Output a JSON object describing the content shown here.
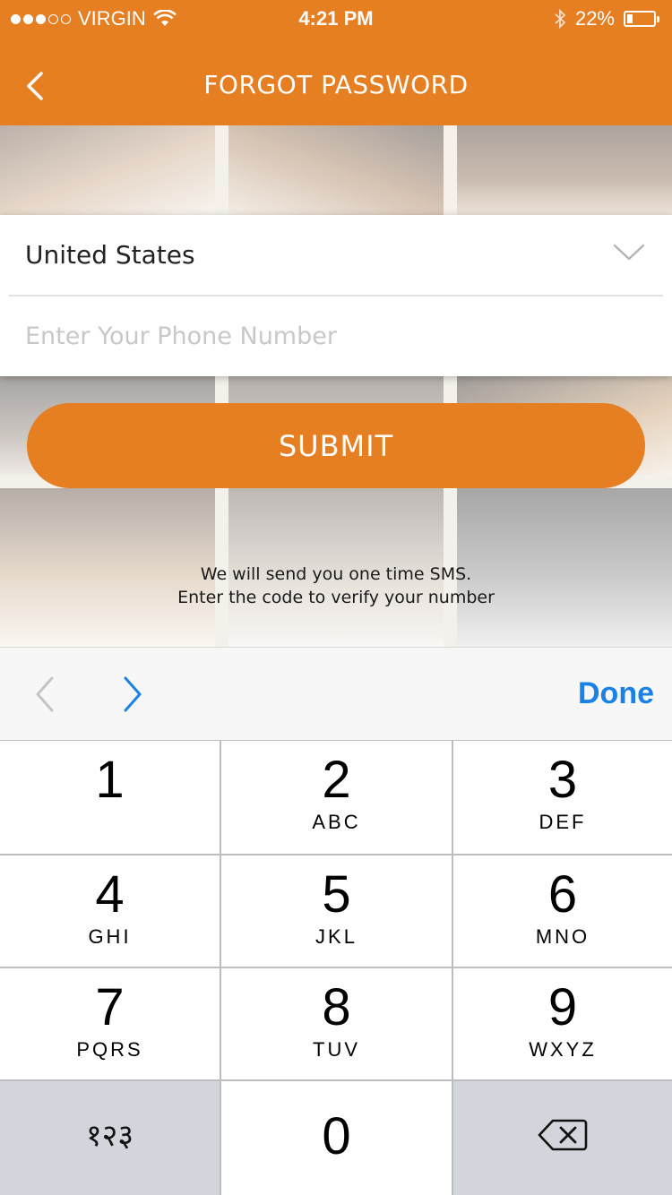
{
  "status_bar": {
    "carrier": "VIRGIN",
    "time": "4:21 PM",
    "battery": "22%",
    "battery_level": 0.22,
    "signal_bars_filled": 3,
    "signal_bars_total": 5
  },
  "nav": {
    "title": "FORGOT PASSWORD",
    "back_icon": "chevron-left-icon"
  },
  "form": {
    "country_value": "United States",
    "phone_placeholder": "Enter Your Phone Number",
    "phone_value": ""
  },
  "submit_label": "SUBMIT",
  "info": {
    "line1": "We will send you one time SMS.",
    "line2": "Enter the code to verify your number"
  },
  "accessory": {
    "done_label": "Done"
  },
  "keypad": {
    "keys": [
      {
        "num": "1",
        "letters": ""
      },
      {
        "num": "2",
        "letters": "ABC"
      },
      {
        "num": "3",
        "letters": "DEF"
      },
      {
        "num": "4",
        "letters": "GHI"
      },
      {
        "num": "5",
        "letters": "JKL"
      },
      {
        "num": "6",
        "letters": "MNO"
      },
      {
        "num": "7",
        "letters": "PQRS"
      },
      {
        "num": "8",
        "letters": "TUV"
      },
      {
        "num": "9",
        "letters": "WXYZ"
      }
    ],
    "alt_label": "१२३",
    "zero": "0",
    "delete_icon": "backspace-icon"
  },
  "colors": {
    "brand": "#e67e22",
    "done_blue": "#1a82e6"
  }
}
